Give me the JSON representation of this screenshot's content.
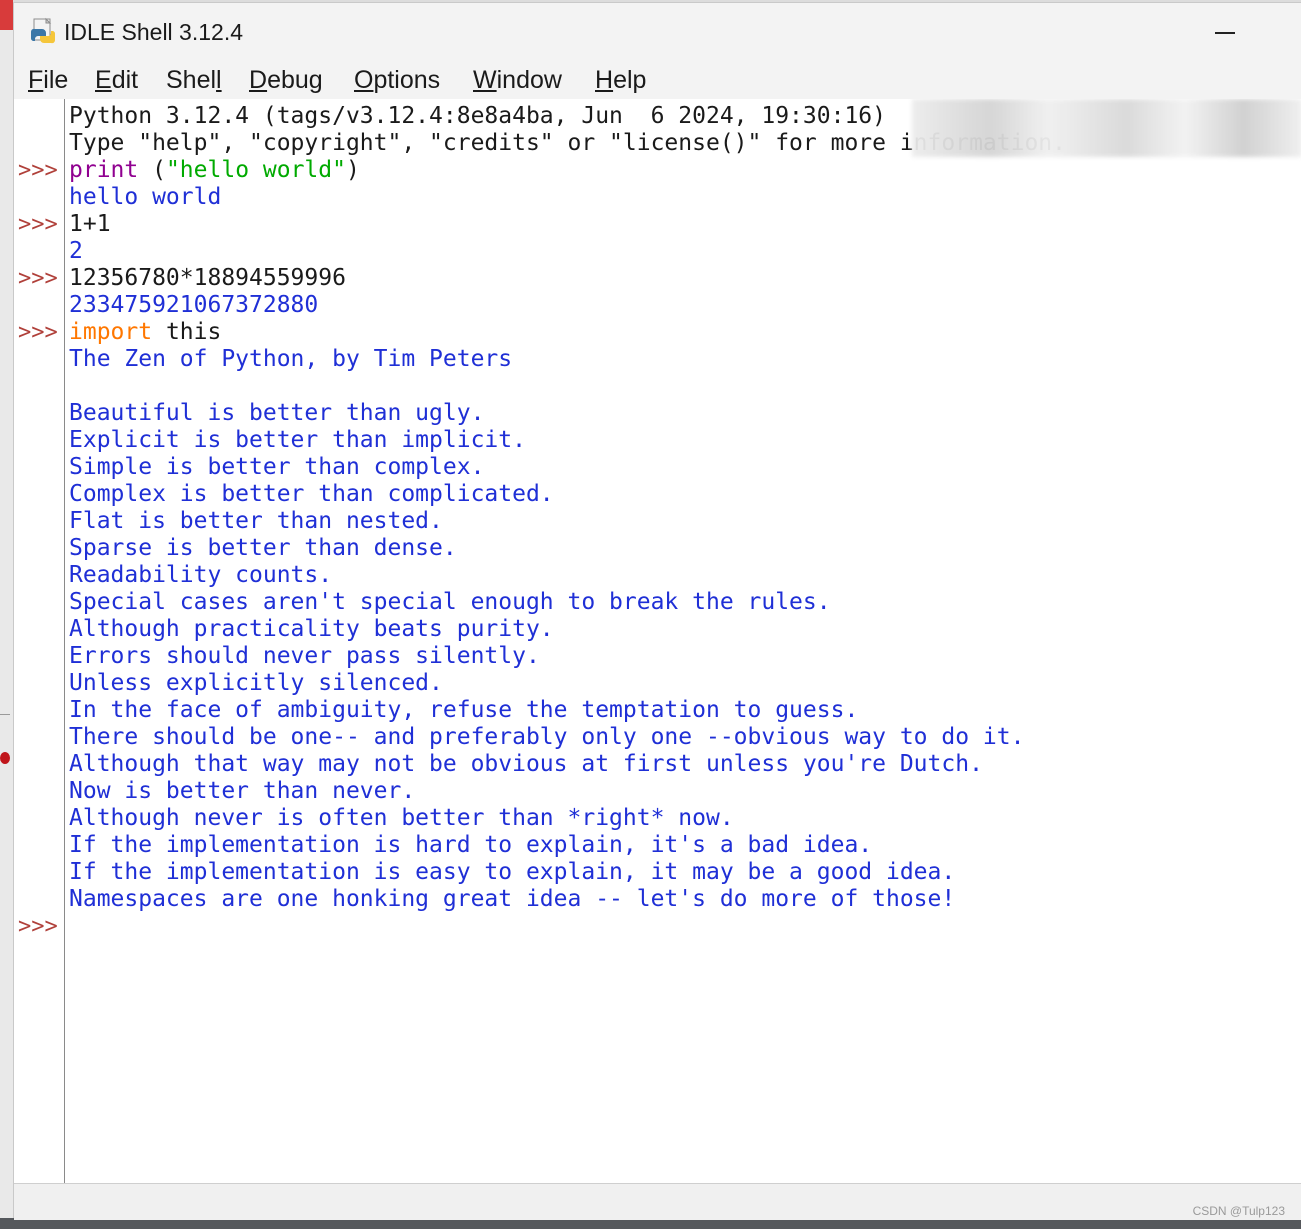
{
  "window": {
    "title": "IDLE Shell 3.12.4",
    "app_icon": "python-idle-icon",
    "controls": [
      "minimize-icon"
    ]
  },
  "menubar": {
    "items": [
      {
        "label": "File",
        "accel": "F"
      },
      {
        "label": "Edit",
        "accel": "E"
      },
      {
        "label": "Shell",
        "accel": "l"
      },
      {
        "label": "Debug",
        "accel": "D"
      },
      {
        "label": "Options",
        "accel": "O"
      },
      {
        "label": "Window",
        "accel": "W"
      },
      {
        "label": "Help",
        "accel": "H"
      }
    ]
  },
  "shell": {
    "prompt": ">>>",
    "banner": [
      "Python 3.12.4 (tags/v3.12.4:8e8a4ba, Jun  6 2024, 19:30:16)",
      "Type \"help\", \"copyright\", \"credits\" or \"license()\" for more information."
    ],
    "cmd1": {
      "builtin": "print",
      "open": " (",
      "string": "\"hello world\"",
      "close": ")"
    },
    "out1": "hello world",
    "cmd2": "1+1",
    "out2": "2",
    "cmd3": "12356780*18894559996",
    "out3": "233475921067372880",
    "cmd4": {
      "keyword": "import",
      "rest": " this"
    },
    "zen_title": "The Zen of Python, by Tim Peters",
    "zen_lines": [
      "Beautiful is better than ugly.",
      "Explicit is better than implicit.",
      "Simple is better than complex.",
      "Complex is better than complicated.",
      "Flat is better than nested.",
      "Sparse is better than dense.",
      "Readability counts.",
      "Special cases aren't special enough to break the rules.",
      "Although practicality beats purity.",
      "Errors should never pass silently.",
      "Unless explicitly silenced.",
      "In the face of ambiguity, refuse the temptation to guess.",
      "There should be one-- and preferably only one --obvious way to do it.",
      "Although that way may not be obvious at first unless you're Dutch.",
      "Now is better than never.",
      "Although never is often better than *right* now.",
      "If the implementation is hard to explain, it's a bad idea.",
      "If the implementation is easy to explain, it may be a good idea.",
      "Namespaces are one honking great idea -- let's do more of those!"
    ]
  },
  "watermark": "CSDN @Tulp123",
  "colors": {
    "prompt": "#b0403a",
    "output": "#1f2fd6",
    "keyword": "#ff7700",
    "builtin": "#900090",
    "string": "#00aa00"
  }
}
